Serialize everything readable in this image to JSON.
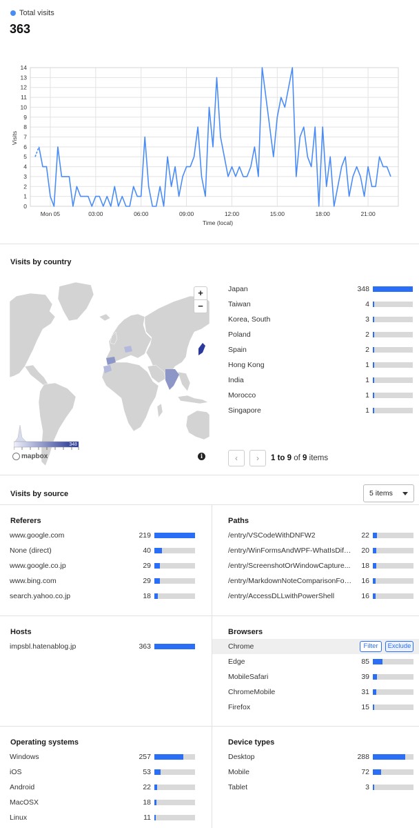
{
  "header": {
    "legend_label": "Total visits",
    "total": "363",
    "series_color": "#4a8cf7"
  },
  "chart_data": {
    "type": "line",
    "ylabel": "Visits",
    "xlabel": "Time (local)",
    "ylim": [
      0,
      14
    ],
    "yticks": [
      0,
      1,
      2,
      3,
      4,
      5,
      6,
      7,
      8,
      9,
      10,
      11,
      12,
      13,
      14
    ],
    "xtick_labels": [
      "Mon 05",
      "03:00",
      "06:00",
      "09:00",
      "12:00",
      "15:00",
      "18:00",
      "21:00"
    ],
    "xtick_hours": [
      1,
      4,
      7,
      10,
      13,
      16,
      19,
      22
    ],
    "x_range_hours": [
      0,
      24
    ],
    "grid": true,
    "hours": [
      0.0,
      0.25,
      0.5,
      0.75,
      1.0,
      1.25,
      1.5,
      1.75,
      2.0,
      2.25,
      2.5,
      2.75,
      3.0,
      3.25,
      3.5,
      3.75,
      4.0,
      4.25,
      4.5,
      4.75,
      5.0,
      5.25,
      5.5,
      5.75,
      6.0,
      6.25,
      6.5,
      6.75,
      7.0,
      7.25,
      7.5,
      7.75,
      8.0,
      8.25,
      8.5,
      8.75,
      9.0,
      9.25,
      9.5,
      9.75,
      10.0,
      10.25,
      10.5,
      10.75,
      11.0,
      11.25,
      11.5,
      11.75,
      12.0,
      12.25,
      12.5,
      12.75,
      13.0,
      13.25,
      13.5,
      13.75,
      14.0,
      14.25,
      14.5,
      14.75,
      15.0,
      15.25,
      15.5,
      15.75,
      16.0,
      16.25,
      16.5,
      16.75,
      17.0,
      17.25,
      17.5,
      17.75,
      18.0,
      18.25,
      18.5,
      18.75,
      19.0,
      19.25,
      19.5,
      19.75,
      20.0,
      20.25,
      20.5,
      20.75,
      21.0,
      21.25,
      21.5,
      21.75,
      22.0,
      22.25,
      22.5,
      22.75,
      23.0,
      23.25,
      23.5,
      23.75,
      24.0
    ],
    "values": [
      5,
      6,
      4,
      4,
      1,
      0,
      6,
      3,
      3,
      3,
      0,
      2,
      1,
      1,
      1,
      0,
      1,
      1,
      0,
      1,
      0,
      2,
      0,
      1,
      0,
      0,
      2,
      1,
      1,
      7,
      2,
      0,
      0,
      2,
      0,
      5,
      2,
      4,
      1,
      3,
      4,
      4,
      5,
      8,
      3,
      1,
      10,
      6,
      13,
      7,
      5,
      3,
      4,
      3,
      4,
      3,
      3,
      4,
      6,
      3,
      14,
      11,
      8,
      5,
      9,
      11,
      10,
      12,
      14,
      3,
      7,
      8,
      5,
      4,
      8,
      0,
      8,
      2,
      5,
      0,
      2,
      4,
      5,
      1,
      3,
      4,
      3,
      1,
      4,
      2,
      2,
      5,
      4,
      4,
      3
    ],
    "dashed_start_count": 2,
    "dashed_end_count": 2
  },
  "country": {
    "title": "Visits by country",
    "max": 348,
    "rows": [
      {
        "label": "Japan",
        "value": 348
      },
      {
        "label": "Taiwan",
        "value": 4
      },
      {
        "label": "Korea, South",
        "value": 3
      },
      {
        "label": "Poland",
        "value": 2
      },
      {
        "label": "Spain",
        "value": 2
      },
      {
        "label": "Hong Kong",
        "value": 1
      },
      {
        "label": "India",
        "value": 1
      },
      {
        "label": "Morocco",
        "value": 1
      },
      {
        "label": "Singapore",
        "value": 1
      }
    ],
    "pager": {
      "range": "1 to 9",
      "of": "of",
      "total": "9",
      "items": "items",
      "prev_icon": "‹",
      "next_icon": "›"
    },
    "map": {
      "zoom_in": "+",
      "zoom_out": "−",
      "legend_max": "348",
      "logo": "mapbox",
      "info": "i"
    }
  },
  "source": {
    "title": "Visits by source",
    "items_select": "5 items"
  },
  "referers": {
    "title": "Referers",
    "max": 219,
    "rows": [
      {
        "label": "www.google.com",
        "value": 219
      },
      {
        "label": "None (direct)",
        "value": 40
      },
      {
        "label": "www.google.co.jp",
        "value": 29
      },
      {
        "label": "www.bing.com",
        "value": 29
      },
      {
        "label": "search.yahoo.co.jp",
        "value": 18
      }
    ]
  },
  "paths": {
    "title": "Paths",
    "max": 219,
    "rows": [
      {
        "label": "/entry/VSCodeWithDNFW2",
        "value": 22
      },
      {
        "label": "/entry/WinFormsAndWPF-WhatIsDiffe...",
        "value": 20
      },
      {
        "label": "/entry/ScreenshotOrWindowCapture...",
        "value": 18
      },
      {
        "label": "/entry/MarkdownNoteComparisonFor...",
        "value": 16
      },
      {
        "label": "/entry/AccessDLLwithPowerShell",
        "value": 16
      }
    ]
  },
  "hosts": {
    "title": "Hosts",
    "max": 363,
    "rows": [
      {
        "label": "impsbl.hatenablog.jp",
        "value": 363
      }
    ]
  },
  "browsers": {
    "title": "Browsers",
    "max": 363,
    "filter_label": "Filter",
    "exclude_label": "Exclude",
    "rows": [
      {
        "label": "Chrome",
        "value": null
      },
      {
        "label": "Edge",
        "value": 85
      },
      {
        "label": "MobileSafari",
        "value": 39
      },
      {
        "label": "ChromeMobile",
        "value": 31
      },
      {
        "label": "Firefox",
        "value": 15
      }
    ]
  },
  "os": {
    "title": "Operating systems",
    "max": 363,
    "rows": [
      {
        "label": "Windows",
        "value": 257
      },
      {
        "label": "iOS",
        "value": 53
      },
      {
        "label": "Android",
        "value": 22
      },
      {
        "label": "MacOSX",
        "value": 18
      },
      {
        "label": "Linux",
        "value": 11
      }
    ]
  },
  "devices": {
    "title": "Device types",
    "max": 363,
    "rows": [
      {
        "label": "Desktop",
        "value": 288
      },
      {
        "label": "Mobile",
        "value": 72
      },
      {
        "label": "Tablet",
        "value": 3
      }
    ]
  },
  "colors": {
    "bar": "#2a6ef5",
    "track": "#d9d9d9",
    "line": "#4a8cf7",
    "land": "#d3d3d3",
    "highlight": "#8d97c7"
  }
}
